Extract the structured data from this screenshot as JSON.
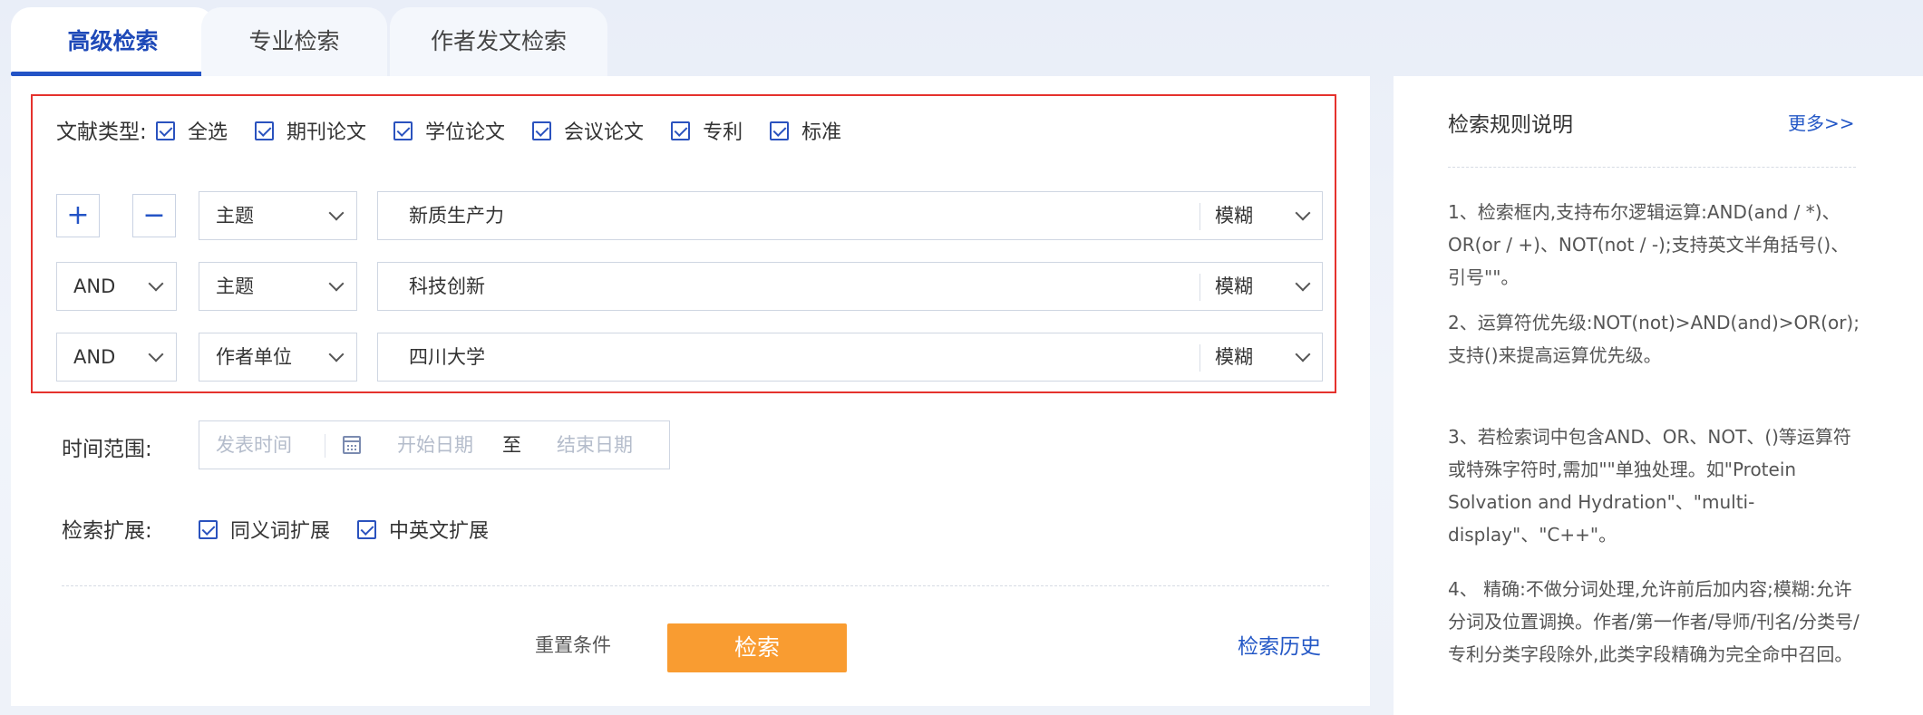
{
  "tabs": [
    {
      "label": "高级检索"
    },
    {
      "label": "专业检索"
    },
    {
      "label": "作者发文检索"
    }
  ],
  "doc_type": {
    "label": "文献类型:",
    "options": [
      {
        "label": "全选",
        "checked": true
      },
      {
        "label": "期刊论文",
        "checked": true
      },
      {
        "label": "学位论文",
        "checked": true
      },
      {
        "label": "会议论文",
        "checked": true
      },
      {
        "label": "专利",
        "checked": true
      },
      {
        "label": "标准",
        "checked": true
      }
    ]
  },
  "controls": {
    "add": "+",
    "remove": "−"
  },
  "query_rows": [
    {
      "logic": "",
      "field": "主题",
      "term": "新质生产力",
      "match": "模糊"
    },
    {
      "logic": "AND",
      "field": "主题",
      "term": "科技创新",
      "match": "模糊"
    },
    {
      "logic": "AND",
      "field": "作者单位",
      "term": "四川大学",
      "match": "模糊"
    }
  ],
  "time_range": {
    "label": "时间范围:",
    "type_placeholder": "发表时间",
    "start_placeholder": "开始日期",
    "separator": "至",
    "end_placeholder": "结束日期"
  },
  "expansion": {
    "label": "检索扩展:",
    "options": [
      {
        "label": "同义词扩展",
        "checked": true
      },
      {
        "label": "中英文扩展",
        "checked": true
      }
    ]
  },
  "actions": {
    "reset": "重置条件",
    "search": "检索",
    "history": "检索历史"
  },
  "rules": {
    "title": "检索规则说明",
    "more": "更多>>",
    "items": [
      "1、检索框内,支持布尔逻辑运算:AND(and / *)、OR(or / +)、NOT(not / -);支持英文半角括号()、引号\"\"。",
      "2、运算符优先级:NOT(not)>AND(and)>OR(or);支持()来提高运算优先级。",
      "3、若检索词中包含AND、OR、NOT、()等运算符或特殊字符时,需加\"\"单独处理。如\"Protein Solvation and Hydration\"、\"multi-display\"、\"C++\"。",
      "4、 精确:不做分词处理,允许前后加内容;模糊:允许分词及位置调换。作者/第一作者/导师/刊名/分类号/专利分类字段除外,此类字段精确为完全命中召回。"
    ]
  },
  "colors": {
    "accent": "#2454c6",
    "search_button": "#f99c31",
    "highlight_border": "#e5322d"
  }
}
